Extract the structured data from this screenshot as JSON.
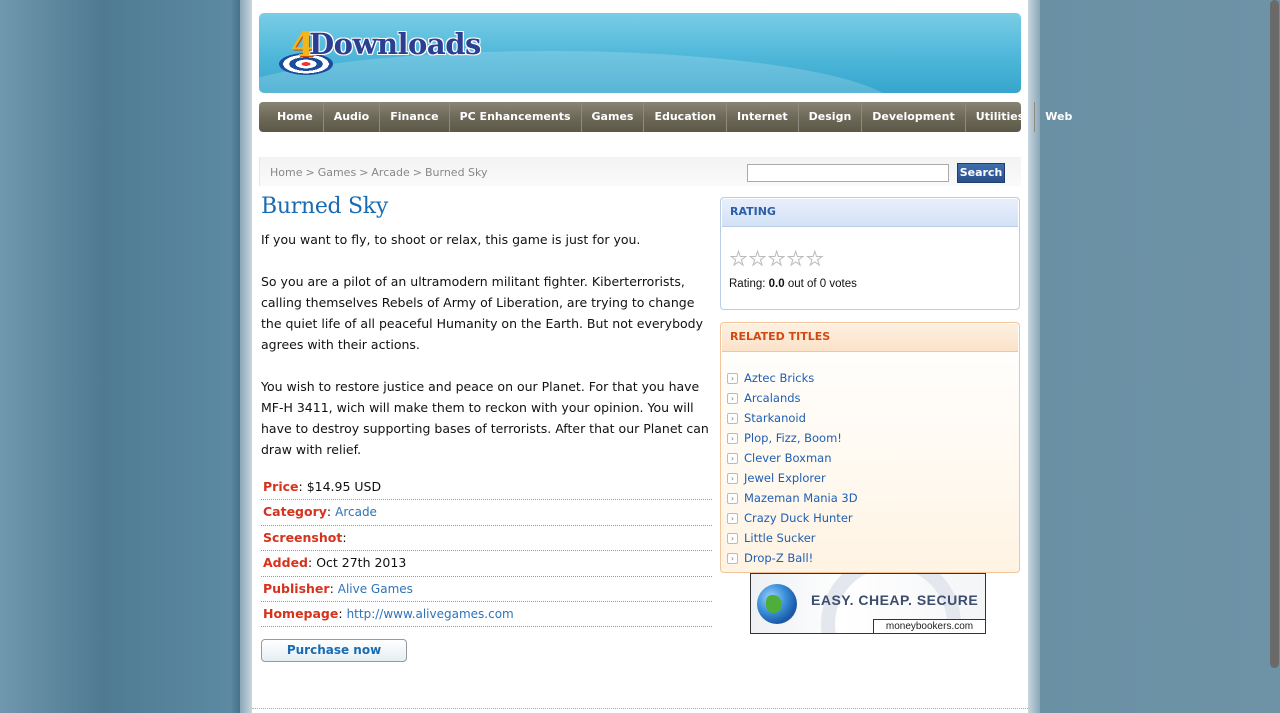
{
  "site": {
    "logo_four": "4",
    "logo_text": "Downloads"
  },
  "nav": [
    "Home",
    "Audio",
    "Finance",
    "PC Enhancements",
    "Games",
    "Education",
    "Internet",
    "Design",
    "Development",
    "Utilities",
    "Web"
  ],
  "breadcrumb": [
    "Home",
    "Games",
    "Arcade",
    "Burned Sky"
  ],
  "search": {
    "value": "",
    "button_label": "Search"
  },
  "product": {
    "title": "Burned Sky",
    "paragraphs": [
      "If you want to fly, to shoot or relax, this game is just for you.",
      "So you are a pilot of an ultramodern militant fighter. Kiberterrorists, calling themselves Rebels of Army of Liberation, are trying to change the quiet life of all peaceful Humanity on the Earth. But not everybody agrees with their actions.",
      "You wish to restore justice and peace on our Planet. For that you have MF-H 3411, wich will make them to reckon with your opinion. You will have to destroy supporting bases of terrorists. After that our Planet can draw with relief."
    ],
    "details": {
      "price_label": "Price",
      "price": "$14.95 USD",
      "category_label": "Category",
      "category": "Arcade",
      "screenshot_label": "Screenshot",
      "screenshot": "",
      "added_label": "Added",
      "added": "Oct 27th 2013",
      "publisher_label": "Publisher",
      "publisher": "Alive Games",
      "homepage_label": "Homepage",
      "homepage": "http://www.alivegames.com"
    },
    "purchase_label": "Purchase now"
  },
  "rating": {
    "header": "RATING",
    "stars_filled": 0,
    "stars_total": 5,
    "label": "Rating:",
    "value": "0.0",
    "suffix": "out of 0 votes"
  },
  "related": {
    "header": "RELATED TITLES",
    "items": [
      "Aztec Bricks",
      "Arcalands",
      "Starkanoid",
      "Plop, Fizz, Boom!",
      "Clever Boxman",
      "Jewel Explorer",
      "Mazeman Mania 3D",
      "Crazy Duck Hunter",
      "Little Sucker",
      "Drop-Z Ball!"
    ]
  },
  "banner": {
    "slogan": "EASY. CHEAP. SECURE",
    "brand": "moneybookers.com"
  },
  "colors": {
    "accent_blue": "#1a6bb3",
    "label_red": "#d6321c",
    "related_orange": "#d14a12"
  }
}
